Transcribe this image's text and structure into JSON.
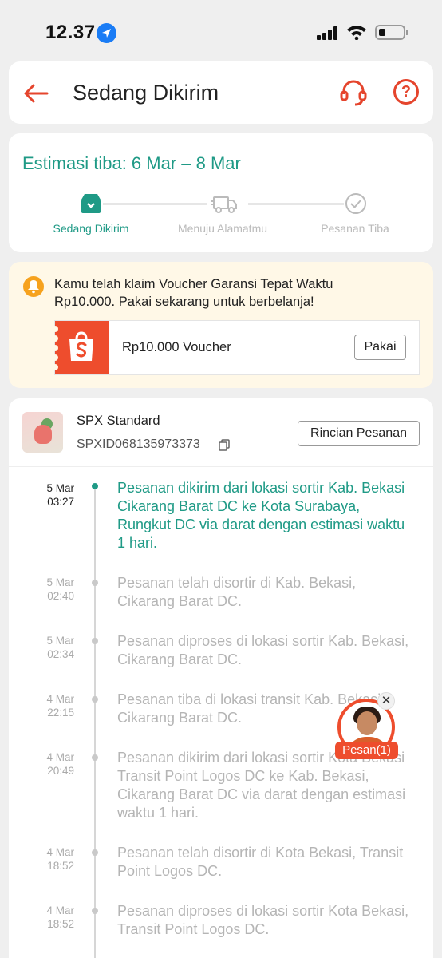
{
  "status_bar": {
    "time": "12.37"
  },
  "header": {
    "title": "Sedang Dikirim"
  },
  "estimate": {
    "text": "Estimasi tiba: 6 Mar – 8 Mar",
    "steps": [
      {
        "label": "Sedang Dikirim",
        "active": true
      },
      {
        "label": "Menuju Alamatmu",
        "active": false
      },
      {
        "label": "Pesanan Tiba",
        "active": false
      }
    ]
  },
  "voucher": {
    "message": "Kamu telah klaim Voucher Garansi Tepat Waktu Rp10.000. Pakai sekarang untuk berbelanja!",
    "name": "Rp10.000 Voucher",
    "button": "Pakai"
  },
  "shipment": {
    "courier": "SPX Standard",
    "tracking_id": "SPXID068135973373",
    "details_button": "Rincian Pesanan",
    "events": [
      {
        "date": "5 Mar",
        "time": "03:27",
        "text": "Pesanan dikirim dari lokasi sortir Kab. Bekasi  Cikarang Barat DC ke Kota Surabaya, Rungkut DC via darat dengan estimasi waktu 1 hari.",
        "active": true
      },
      {
        "date": "5 Mar",
        "time": "02:40",
        "text": "Pesanan telah disortir di Kab. Bekasi, Cikarang Barat DC.",
        "active": false
      },
      {
        "date": "5 Mar",
        "time": "02:34",
        "text": "Pesanan diproses di lokasi sortir Kab. Bekasi, Cikarang Barat DC.",
        "active": false
      },
      {
        "date": "4 Mar",
        "time": "22:15",
        "text": "Pesanan tiba di lokasi transit Kab. Bekasi, Cikarang Barat DC.",
        "active": false
      },
      {
        "date": "4 Mar",
        "time": "20:49",
        "text": "Pesanan dikirim dari lokasi sortir Kota Bekasi  Transit Point Logos DC ke Kab. Bekasi, Cikarang Barat DC via darat dengan estimasi waktu 1 hari.",
        "active": false
      },
      {
        "date": "4 Mar",
        "time": "18:52",
        "text": "Pesanan telah disortir di Kota Bekasi, Transit Point Logos DC.",
        "active": false
      },
      {
        "date": "4 Mar",
        "time": "18:52",
        "text": "Pesanan diproses di lokasi sortir Kota Bekasi, Transit Point Logos DC.",
        "active": false
      }
    ]
  },
  "chat": {
    "badge": "Pesan(1)"
  },
  "colors": {
    "accent_orange": "#ee4d2d",
    "teal": "#1f9a86",
    "voucher_bg": "#fff8e7"
  }
}
